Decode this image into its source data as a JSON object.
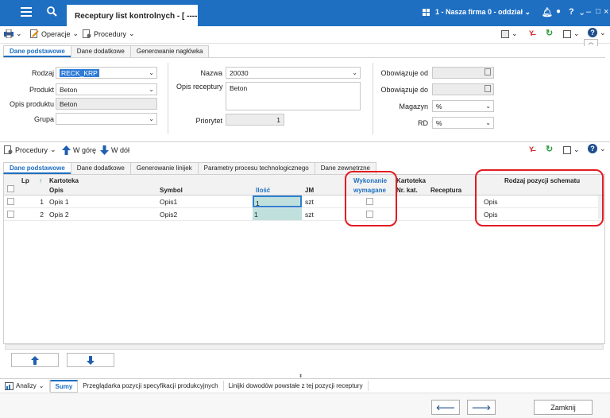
{
  "titlebar": {
    "tab_title": "Receptury list kontrolnych - [ ----, CI",
    "firm": "1 - Nasza firma 0 - oddział",
    "accent": "#1e6fc2"
  },
  "toolbar": {
    "operacje": "Operacje",
    "procedury": "Procedury"
  },
  "header_tabs": [
    "Dane podstawowe",
    "Dane dodatkowe",
    "Generowanie nagłówka"
  ],
  "form": {
    "rodzaj_label": "Rodzaj",
    "rodzaj_value": "RECK_KRP",
    "produkt_label": "Produkt",
    "produkt_value": "Beton",
    "opis_produktu_label": "Opis produktu",
    "opis_produktu_value": "Beton",
    "grupa_label": "Grupa",
    "grupa_value": "",
    "nazwa_label": "Nazwa",
    "nazwa_value": "20030",
    "opis_receptury_label": "Opis receptury",
    "opis_receptury_value": "Beton",
    "priorytet_label": "Priorytet",
    "priorytet_value": "1",
    "obowiazuje_od_label": "Obowiązuje od",
    "obowiazuje_od_value": "",
    "obowiazuje_do_label": "Obowiązuje do",
    "obowiazuje_do_value": "",
    "magazyn_label": "Magazyn",
    "magazyn_value": "%",
    "rd_label": "RD",
    "rd_value": "%"
  },
  "toolbar2": {
    "procedury": "Procedury",
    "w_gore": "W górę",
    "w_dol": "W dół"
  },
  "detail_tabs": [
    "Dane podstawowe",
    "Dane dodatkowe",
    "Generowanie linijek",
    "Parametry procesu technologicznego",
    "Dane zewnętrzne"
  ],
  "grid": {
    "headers": {
      "lp": "Lp",
      "kartoteka": "Kartoteka",
      "opis": "Opis",
      "symbol": "Symbol",
      "ilosc": "Ilość",
      "jm": "JM",
      "wykonanie": "Wykonanie",
      "wymagane": "wymagane",
      "kartoteka2": "Kartoteka",
      "nr_kat": "Nr. kat.",
      "receptura": "Receptura",
      "rodzaj_pozycji": "Rodzaj pozycji schematu"
    },
    "rows": [
      {
        "lp": "1",
        "opis": "Opis 1",
        "symbol": "Opis1",
        "ilosc": "1",
        "jm": "szt",
        "rodzaj": "Opis"
      },
      {
        "lp": "2",
        "opis": "Opis 2",
        "symbol": "Opis2",
        "ilosc": "1",
        "jm": "szt",
        "rodzaj": "Opis"
      }
    ]
  },
  "bottom": {
    "analizy": "Analizy",
    "tabs": [
      "Sumy",
      "Przeglądarka pozycji specyfikacji produkcyjnych",
      "Linijki dowodów powstałe z tej pozycji receptury"
    ],
    "zamknij": "Zamknij"
  }
}
